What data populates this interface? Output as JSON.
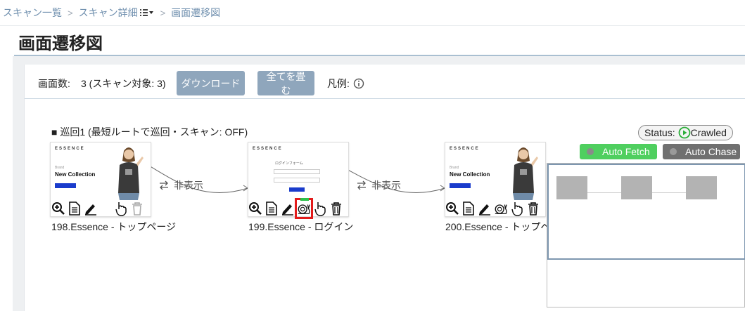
{
  "breadcrumb": {
    "items": [
      "スキャン一覧",
      "スキャン詳細",
      "画面遷移図"
    ]
  },
  "page": {
    "title": "画面遷移図"
  },
  "toolbar": {
    "count_label": "画面数:",
    "count_value": "3 (スキャン対象: 3)",
    "download_label": "ダウンロード",
    "collapse_label": "全てを畳む",
    "legend_label": "凡例:"
  },
  "section": {
    "title": "■ 巡回1 (最短ルートで巡回・スキャン: OFF)"
  },
  "status": {
    "label": "Status:",
    "value": "Crawled"
  },
  "toggles": {
    "auto_fetch": "Auto Fetch",
    "auto_chase": "Auto Chase"
  },
  "nodes": [
    {
      "label": "198.Essence - トップページ",
      "nav": "ESSENCE",
      "collection_small": "Brand",
      "collection_title": "New Collection"
    },
    {
      "label": "199.Essence - ログイン",
      "nav": "ESSENCE",
      "login_title": "ログインフォーム"
    },
    {
      "label": "200.Essence - トップペ",
      "nav": "ESSENCE",
      "collection_small": "Brand",
      "collection_title": "New Collection"
    }
  ],
  "edges": [
    {
      "label": "非表示"
    },
    {
      "label": "非表示"
    }
  ],
  "icons": [
    "zoom-in-icon",
    "document-icon",
    "pencil-icon",
    "snail-icon",
    "pointer-hand-icon",
    "trash-icon"
  ],
  "colors": {
    "toolbar_button": "#8fa6bc",
    "auto_fetch": "#4fcf5f",
    "auto_chase": "#707070",
    "highlight": "#e31b1b",
    "crawled": "#2cae3a"
  }
}
